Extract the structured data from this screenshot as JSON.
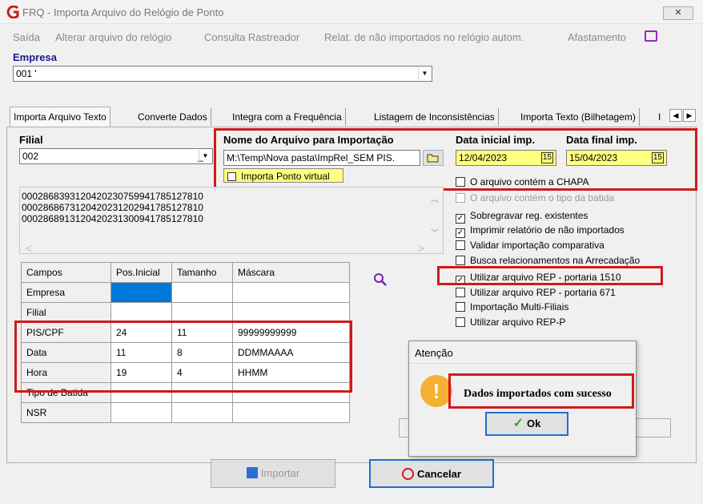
{
  "window": {
    "title": "FRQ - Importa Arquivo do Relógio de Ponto",
    "close_label": "✕"
  },
  "menu": [
    "Saída",
    "Alterar arquivo do relógio",
    "Consulta Rastreador",
    "Relat. de não importados no relógio autom.",
    "Afastamento"
  ],
  "empresa": {
    "label": "Empresa",
    "value": "001 '"
  },
  "tabs": [
    "Importa Arquivo Texto",
    "Converte Dados",
    "Integra com a Frequência",
    "Listagem de Inconsistências",
    "Importa Texto (Bilhetagem)",
    "I"
  ],
  "filial": {
    "label": "Filial",
    "value": "002",
    "suffix": "_"
  },
  "arquivo": {
    "label": "Nome do Arquivo para Importação",
    "value": "M:\\Temp\\Nova pasta\\ImpRel_SEM PIS.",
    "virtual_label": "Importa Ponto virtual"
  },
  "datas": {
    "inicial_label": "Data inicial imp.",
    "inicial_value": "12/04/2023",
    "final_label": "Data final imp.",
    "final_value": "15/04/2023"
  },
  "preview_lines": [
    "0002868393120420230759941785127810",
    "0002868673120420231202941785127810",
    "0002868913120420231300941785127810"
  ],
  "options": [
    {
      "label": "O arquivo contém a CHAPA",
      "checked": false,
      "enabled": true
    },
    {
      "label": "O arquivo contém o tipo da batida",
      "checked": false,
      "enabled": false
    },
    {
      "label": "Sobregravar reg. existentes",
      "checked": true,
      "enabled": true
    },
    {
      "label": "Imprimir relatório de não importados",
      "checked": true,
      "enabled": true
    },
    {
      "label": "Validar importação comparativa",
      "checked": false,
      "enabled": true
    },
    {
      "label": "Busca relacionamentos na Arrecadação",
      "checked": false,
      "enabled": true
    },
    {
      "label": "Utilizar arquivo REP - portaria 1510",
      "checked": true,
      "enabled": true
    },
    {
      "label": "Utilizar arquivo REP - portaria 671",
      "checked": false,
      "enabled": true
    },
    {
      "label": "Importação Multi-Filiais",
      "checked": false,
      "enabled": true
    },
    {
      "label": "Utilizar arquivo REP-P",
      "checked": false,
      "enabled": true
    }
  ],
  "grid": {
    "headers": [
      "Campos",
      "Pos.Inicial",
      "Tamanho",
      "Máscara"
    ],
    "rows": [
      [
        "Empresa",
        "",
        "",
        ""
      ],
      [
        "Filial",
        "",
        "",
        ""
      ],
      [
        "PIS/CPF",
        "24",
        "11",
        "99999999999"
      ],
      [
        "Data",
        "11",
        "8",
        "DDMMAAAA"
      ],
      [
        "Hora",
        "19",
        "4",
        "HHMM"
      ],
      [
        "Tipo de Batida",
        "",
        "",
        ""
      ],
      [
        "NSR",
        "",
        "",
        ""
      ]
    ]
  },
  "dialog": {
    "title": "Atenção",
    "message": "Dados importados com sucesso",
    "ok_label": "Ok"
  },
  "buttons": {
    "importar": "Importar",
    "cancelar": "Cancelar"
  },
  "colors": {
    "highlight": "#ffff80",
    "accent_red": "#d01a1a",
    "selected_cell": "#0078d7"
  }
}
